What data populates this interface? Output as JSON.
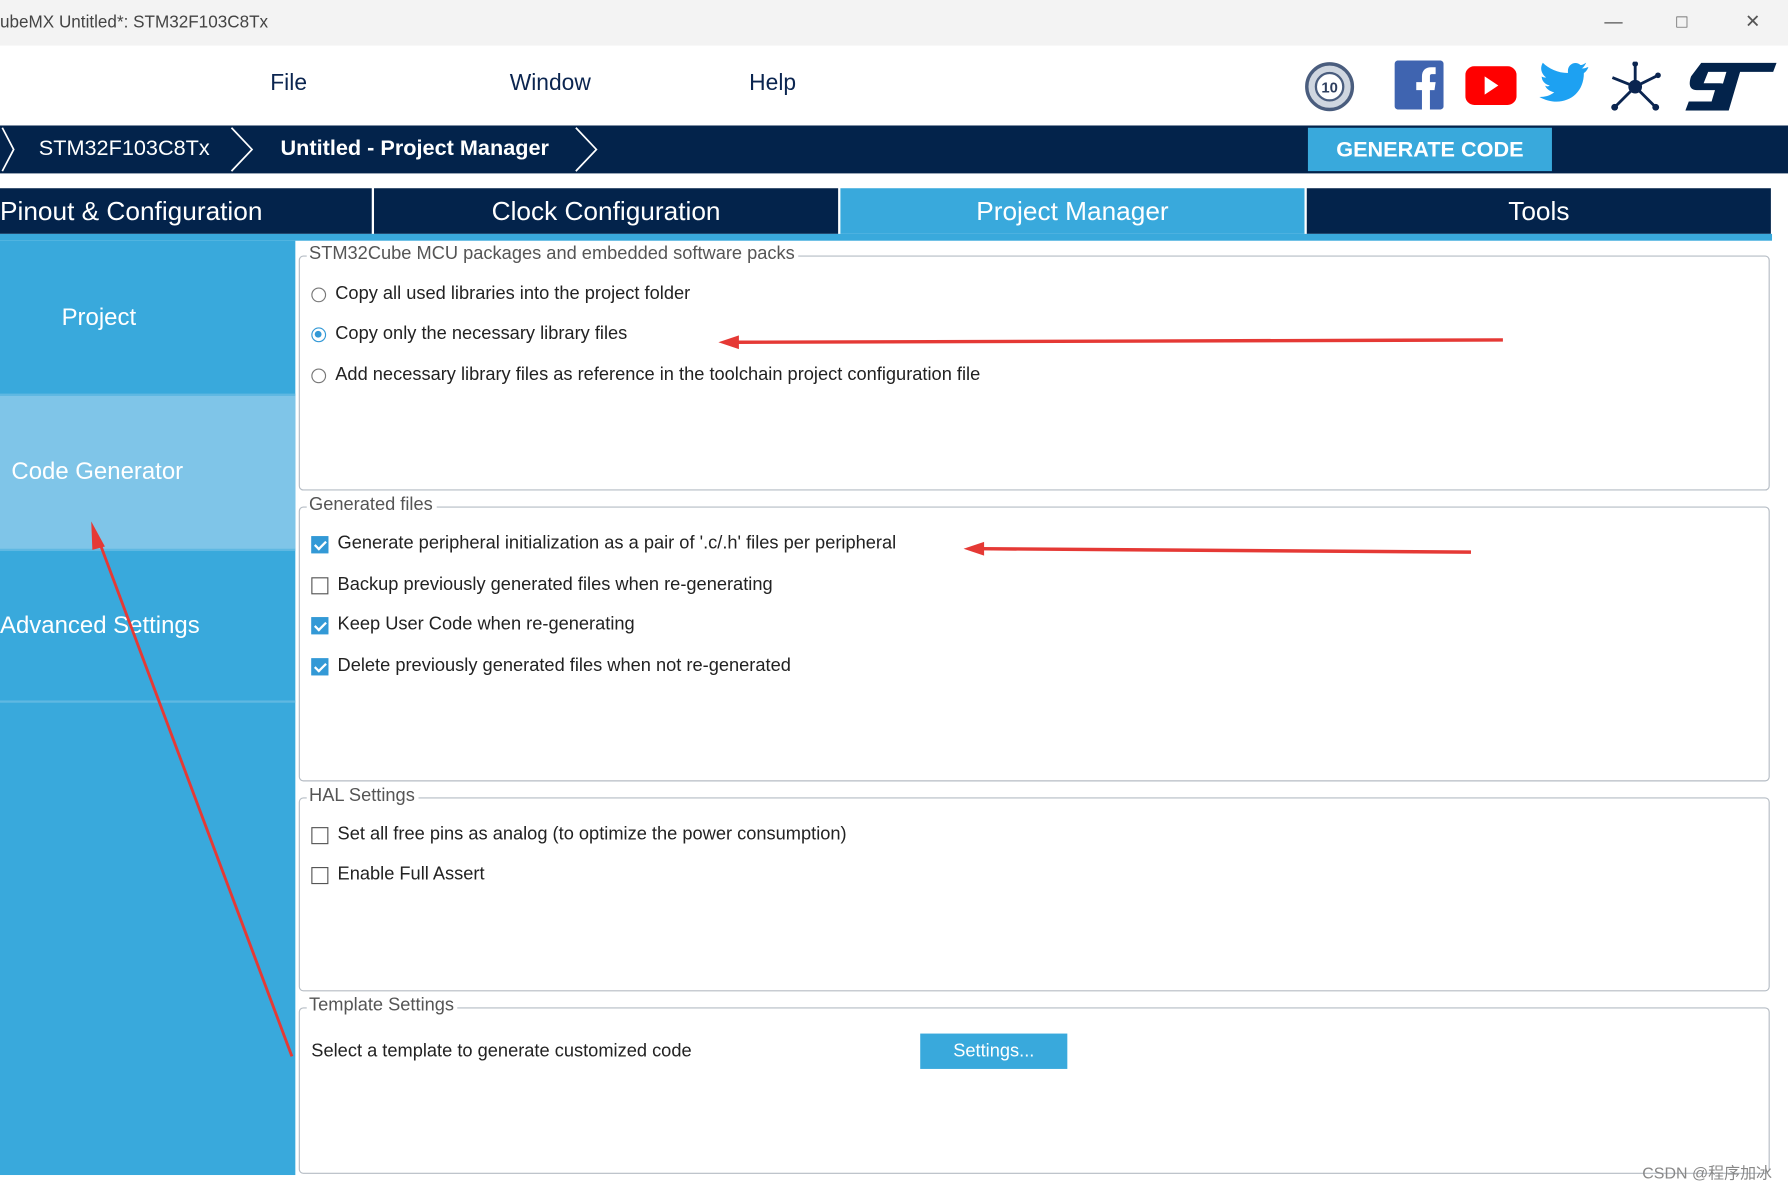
{
  "window": {
    "title": "ubeMX Untitled*: STM32F103C8Tx",
    "controls": [
      "minimize",
      "maximize",
      "close"
    ]
  },
  "menu": {
    "items": [
      "File",
      "Window",
      "Help"
    ]
  },
  "social_icons": [
    "anniversary-10-years-icon",
    "facebook-icon",
    "youtube-icon",
    "twitter-icon",
    "network-icon",
    "st-logo"
  ],
  "breadcrumb": {
    "items": [
      "STM32F103C8Tx",
      "Untitled - Project Manager"
    ]
  },
  "generate_button": "GENERATE CODE",
  "tabs": [
    {
      "label": "Pinout & Configuration"
    },
    {
      "label": "Clock Configuration"
    },
    {
      "label": "Project Manager",
      "active": true
    },
    {
      "label": "Tools"
    }
  ],
  "sidebar": {
    "items": [
      {
        "label": "Project"
      },
      {
        "label": "Code Generator",
        "selected": true
      },
      {
        "label": "Advanced Settings"
      }
    ]
  },
  "groups": {
    "packages": {
      "title": "STM32Cube MCU packages and embedded software packs",
      "options": [
        {
          "label": "Copy all used libraries into the project folder",
          "selected": false
        },
        {
          "label": "Copy only the necessary library files",
          "selected": true
        },
        {
          "label": "Add necessary library files as reference in the toolchain project configuration file",
          "selected": false
        }
      ]
    },
    "generated": {
      "title": "Generated files",
      "options": [
        {
          "label": "Generate peripheral initialization as a pair of '.c/.h' files per peripheral",
          "checked": true
        },
        {
          "label": "Backup previously generated files when re-generating",
          "checked": false
        },
        {
          "label": "Keep User Code when re-generating",
          "checked": true
        },
        {
          "label": "Delete previously generated files when not re-generated",
          "checked": true
        }
      ]
    },
    "hal": {
      "title": "HAL Settings",
      "options": [
        {
          "label": "Set all free pins as analog (to optimize the power consumption)",
          "checked": false
        },
        {
          "label": "Enable Full Assert",
          "checked": false
        }
      ]
    },
    "template": {
      "title": "Template Settings",
      "text": "Select a template to generate customized code",
      "button": "Settings..."
    }
  },
  "watermark": "CSDN @程序加冰",
  "colors": {
    "navy": "#03234b",
    "accent": "#39a9dc",
    "selected_sidebar": "#7fc5e8",
    "annotation": "#e53935"
  }
}
